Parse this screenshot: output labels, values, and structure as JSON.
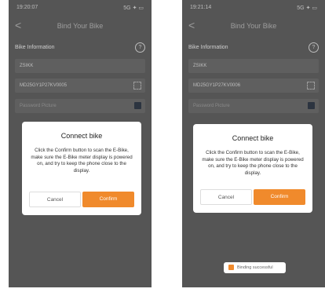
{
  "left": {
    "status_time": "19:20:07",
    "status_icons": "5G ✦ ▭",
    "back_label": "<",
    "title": "Bind Your Bike",
    "section_label": "Bike Information",
    "help_label": "?",
    "field_name": "ZSIKK",
    "field_serial": "MD25GY1P27KV0005",
    "field_password": "Password Picture",
    "dialog": {
      "title": "Connect bike",
      "message": "Click the Confirm button to scan the E-Bike, make sure the E-Bike meter display is powered on, and try to keep the phone close to the display.",
      "cancel": "Cancel",
      "confirm": "Confirm"
    }
  },
  "right": {
    "status_time": "19:21:14",
    "status_icons": "5G ✦ ▭",
    "back_label": "<",
    "title": "Bind Your Bike",
    "section_label": "Bike Information",
    "help_label": "?",
    "field_name": "ZSIKK",
    "field_serial": "MD25GY1P27KV0006",
    "field_password": "Password Picture",
    "dialog": {
      "title": "Connect bike",
      "message": "Click the Confirm button to scan the E-Bike, make sure the E-Bike meter display is powered on, and try to keep the phone close to the display.",
      "cancel": "Cancel",
      "confirm": "Confirm"
    },
    "toast": "Binding successful"
  },
  "colors": {
    "overlay": "#555555",
    "accent": "#f08a2c",
    "dialog_bg": "#ffffff"
  }
}
